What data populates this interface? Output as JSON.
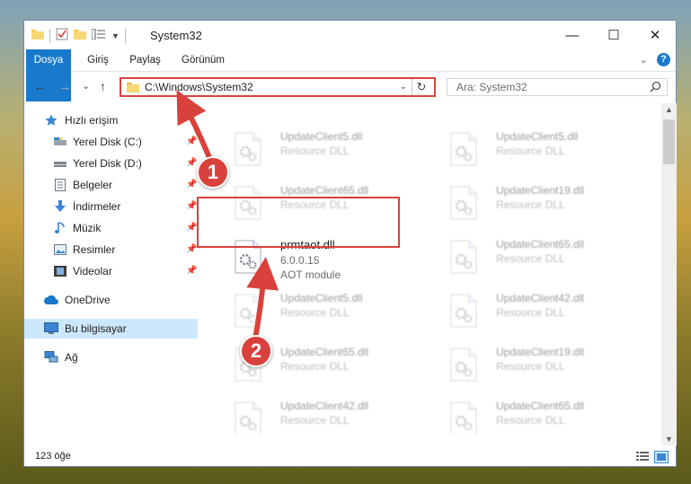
{
  "window": {
    "title": "System32",
    "controls": {
      "minimize": "—",
      "maximize": "☐",
      "close": "✕"
    }
  },
  "ribbon": {
    "tabs": [
      "Dosya",
      "Giriş",
      "Paylaş",
      "Görünüm"
    ],
    "expand_icon": "chevron-down-icon",
    "help_label": "?"
  },
  "navigation": {
    "back": "←",
    "forward": "→",
    "recent": "⌄",
    "up": "↑",
    "address": "C:\\Windows\\System32",
    "search_placeholder": "Ara: System32"
  },
  "sidebar": {
    "items": [
      {
        "label": "Hızlı erişim",
        "icon": "star-icon"
      },
      {
        "label": "Yerel Disk (C:)",
        "icon": "drive-icon"
      },
      {
        "label": "Yerel Disk (D:)",
        "icon": "drive-icon"
      },
      {
        "label": "Belgeler",
        "icon": "documents-icon"
      },
      {
        "label": "İndirmeler",
        "icon": "download-icon"
      },
      {
        "label": "Müzik",
        "icon": "music-icon"
      },
      {
        "label": "Resimler",
        "icon": "pictures-icon"
      },
      {
        "label": "Videolar",
        "icon": "videos-icon"
      },
      {
        "label": "OneDrive",
        "icon": "cloud-icon"
      },
      {
        "label": "Bu bilgisayar",
        "icon": "computer-icon"
      },
      {
        "label": "Ağ",
        "icon": "network-icon"
      }
    ]
  },
  "files": {
    "left": [
      {
        "name": "UpdateClient5.dll",
        "sub": "Resource DLL"
      },
      {
        "name": "UpdateClient65.dll",
        "sub": "Resource DLL"
      },
      {
        "name": "prmtaot.dll",
        "sub": "6.0.0.15",
        "sub2": "AOT module"
      },
      {
        "name": "UpdateClient5.dll",
        "sub": "Resource DLL"
      },
      {
        "name": "UpdateClient65.dll",
        "sub": "Resource DLL"
      },
      {
        "name": "UpdateClient42.dll",
        "sub": "Resource DLL"
      }
    ],
    "right": [
      {
        "name": "UpdateClient5.dll",
        "sub": "Resource DLL"
      },
      {
        "name": "UpdateClient19.dll",
        "sub": "Resource DLL"
      },
      {
        "name": "UpdateClient65.dll",
        "sub": "Resource DLL"
      },
      {
        "name": "UpdateClient42.dll",
        "sub": "Resource DLL"
      },
      {
        "name": "UpdateClient19.dll",
        "sub": "Resource DLL"
      },
      {
        "name": "UpdateClient65.dll",
        "sub": "Resource DLL"
      }
    ]
  },
  "status": {
    "count": "123 öğe"
  },
  "annotations": {
    "step1": "1",
    "step2": "2",
    "color": "#d9423c"
  },
  "colors": {
    "accent": "#1979ca",
    "selected": "#cce8ff",
    "annotation": "#d9423c"
  }
}
